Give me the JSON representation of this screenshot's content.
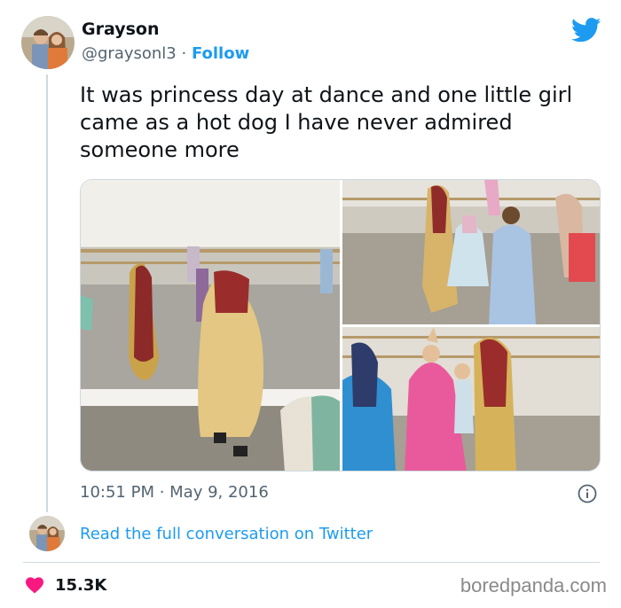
{
  "author": {
    "name": "Grayson",
    "handle": "@graysonl3",
    "separator": " · ",
    "follow_label": "Follow"
  },
  "tweet": {
    "text": "It was princess day at dance and one little girl came as a hot dog I have never admired someone more",
    "timestamp": "10:51 PM · May 9, 2016"
  },
  "footer": {
    "read_link": "Read the full conversation on Twitter",
    "likes": "15.3K",
    "watermark": "boredpanda.com"
  },
  "icons": {
    "brand": "twitter-bird-icon",
    "info": "info-icon",
    "like": "heart-icon"
  },
  "colors": {
    "twitter_blue": "#1d9bf0",
    "heart_red": "#f91880",
    "text_primary": "#0f1419",
    "text_secondary": "#536471",
    "border": "#cfd9de"
  }
}
